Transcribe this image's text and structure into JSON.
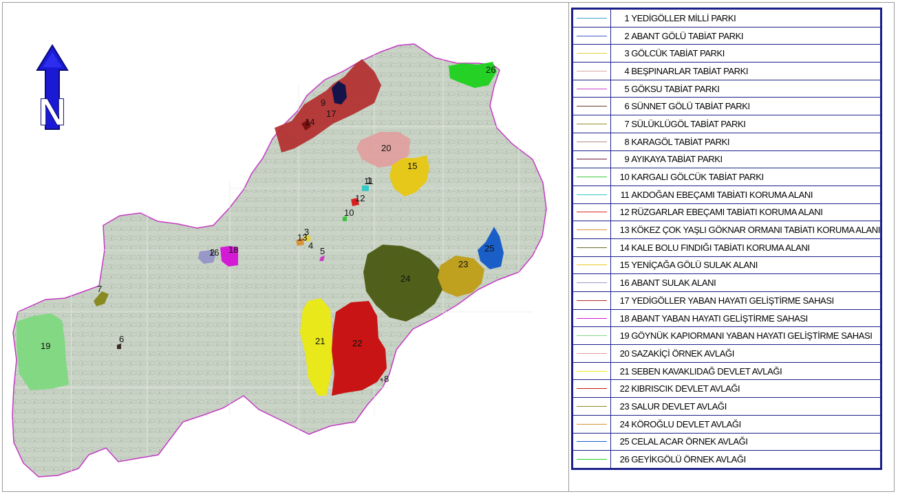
{
  "map": {
    "north_label": "N",
    "area_labels": [
      {
        "num": "1",
        "color": "#3aa6c9"
      },
      {
        "num": "2",
        "color": "#4057c8"
      },
      {
        "num": "3",
        "color": "#e3d23a"
      },
      {
        "num": "4",
        "color": "#d9a3a3"
      },
      {
        "num": "5",
        "color": "#c83cc8"
      },
      {
        "num": "6",
        "color": "#6b3a2a"
      },
      {
        "num": "7",
        "color": "#8a8a22"
      },
      {
        "num": "8",
        "color": "#b58a8a"
      },
      {
        "num": "9",
        "color": "#6a123a"
      },
      {
        "num": "10",
        "color": "#3ac83a"
      },
      {
        "num": "11",
        "color": "#35c9c9"
      },
      {
        "num": "12",
        "color": "#d92020"
      },
      {
        "num": "13",
        "color": "#d9913a"
      },
      {
        "num": "14",
        "color": "#6b6b2a"
      },
      {
        "num": "15",
        "color": "#e6c81a"
      },
      {
        "num": "16",
        "color": "#9898c8"
      },
      {
        "num": "17",
        "color": "#b22e2e"
      },
      {
        "num": "18",
        "color": "#d41ad4"
      },
      {
        "num": "19",
        "color": "#7fd87f"
      },
      {
        "num": "20",
        "color": "#e39a9a"
      },
      {
        "num": "21",
        "color": "#e8e81a"
      },
      {
        "num": "22",
        "color": "#c81414"
      },
      {
        "num": "23",
        "color": "#bfa01f"
      },
      {
        "num": "24",
        "color": "#4a5a12"
      },
      {
        "num": "25",
        "color": "#1a5ec8"
      },
      {
        "num": "26",
        "color": "#1ed11e"
      }
    ]
  },
  "legend": {
    "items": [
      {
        "num": "1",
        "label": "YEDİGÖLLER MİLLİ PARKI",
        "color": "#3aa6c9"
      },
      {
        "num": "2",
        "label": "ABANT GÖLÜ TABİAT PARKI",
        "color": "#4057c8"
      },
      {
        "num": "3",
        "label": "GÖLCÜK TABİAT PARKI",
        "color": "#e3d23a"
      },
      {
        "num": "4",
        "label": "BEŞPINARLAR TABİAT PARKI",
        "color": "#d9a3a3"
      },
      {
        "num": "5",
        "label": "GÖKSU TABİAT PARKI",
        "color": "#c83cc8"
      },
      {
        "num": "6",
        "label": "SÜNNET GÖLÜ TABİAT PARKI",
        "color": "#6b3a2a"
      },
      {
        "num": "7",
        "label": "SÜLÜKLÜGÖL TABİAT PARKI",
        "color": "#8a8a22"
      },
      {
        "num": "8",
        "label": "KARAGÖL TABİAT PARKI",
        "color": "#b58a8a"
      },
      {
        "num": "9",
        "label": "AYIKAYA TABİAT PARKI",
        "color": "#6a123a"
      },
      {
        "num": "10",
        "label": "KARGALI GÖLCÜK TABİAT PARKI",
        "color": "#3ac83a"
      },
      {
        "num": "11",
        "label": "AKDOĞAN EBEÇAMI TABİATI KORUMA ALANI",
        "color": "#35c9c9"
      },
      {
        "num": "12",
        "label": "RÜZGARLAR EBEÇAMI TABİATI KORUMA ALANI",
        "color": "#d92020"
      },
      {
        "num": "13",
        "label": "KÖKEZ ÇOK YAŞLI GÖKNAR ORMANI TABİATI KORUMA ALANI",
        "color": "#d9913a"
      },
      {
        "num": "14",
        "label": "KALE BOLU FINDIĞI TABİATI KORUMA ALANI",
        "color": "#6b6b2a"
      },
      {
        "num": "15",
        "label": "YENİÇAĞA GÖLÜ SULAK ALANI",
        "color": "#e6c81a"
      },
      {
        "num": "16",
        "label": "ABANT SULAK ALANI",
        "color": "#9898c8"
      },
      {
        "num": "17",
        "label": "YEDİGÖLLER YABAN HAYATI GELİŞTİRME SAHASI",
        "color": "#b22e2e"
      },
      {
        "num": "18",
        "label": "ABANT YABAN HAYATI GELİŞTİRME SAHASI",
        "color": "#d41ad4"
      },
      {
        "num": "19",
        "label": "GÖYNÜK KAPIORMANI YABAN HAYATI GELİŞTİRME SAHASI",
        "color": "#7fd87f"
      },
      {
        "num": "20",
        "label": "SAZAKİÇİ ÖRNEK AVLAĞI",
        "color": "#e39a9a"
      },
      {
        "num": "21",
        "label": "SEBEN KAVAKLIDAĞ DEVLET AVLAĞI",
        "color": "#e8e81a"
      },
      {
        "num": "22",
        "label": "KIBRISCIK DEVLET AVLAĞI",
        "color": "#c81414"
      },
      {
        "num": "23",
        "label": "SALUR DEVLET AVLAĞI",
        "color": "#8a8a22"
      },
      {
        "num": "24",
        "label": "KÖROĞLU DEVLET AVLAĞI",
        "color": "#d9913a"
      },
      {
        "num": "25",
        "label": "CELAL ACAR ÖRNEK AVLAĞI",
        "color": "#1a5ec8"
      },
      {
        "num": "26",
        "label": "GEYİKGÖLÜ ÖRNEK AVLAĞI",
        "color": "#1ed11e"
      }
    ]
  }
}
